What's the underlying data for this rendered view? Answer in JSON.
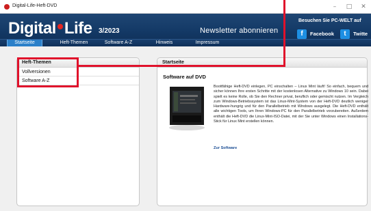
{
  "window": {
    "title": "Digital-Life-Heft-DVD",
    "controls": [
      "–",
      "□",
      "✕"
    ]
  },
  "header": {
    "logo_part1": "Digital",
    "logo_part2": "Life",
    "issue": "3/2023",
    "newsletter": "Newsletter abonnieren",
    "visit_text": "Besuchen Sie PC-WELT auf",
    "facebook_label": "Facebook",
    "twitter_label": "Twitte",
    "facebook_icon": "f",
    "twitter_icon": "t"
  },
  "nav": {
    "items": [
      {
        "label": "Startseite"
      },
      {
        "label": "Heft-Themen"
      },
      {
        "label": "Software A-Z"
      },
      {
        "label": "Hinweis"
      },
      {
        "label": "Impressum"
      }
    ]
  },
  "sidebar": {
    "title": "Heft-Themen",
    "items": [
      {
        "label": "Vollversionen"
      },
      {
        "label": "Software A-Z"
      }
    ]
  },
  "main": {
    "title": "Startseite",
    "section_title": "Software auf DVD",
    "article": "Boottfähige Heft-DVD einlegen, PC einschalten – Linux Mint läuft! So einfach, bequem und sicher können Ihre ersten Schritte mit der kostenlosen Alternative zu Windows 10 sein. Dabei spielt es keine Rolle, ob Sie den Rechner privat, beruflich oder gemischt nutzen. Im Vergleich zum Windows-Betriebssystem ist das Linux-Mint-System von der Heft-DVD deutlich weniger Hardware-hungrig und für den Parallelbetrieb mit Windows ausgelegt. Die Heft-DVD enthält alle wichtigen Tools, um Ihren Windows-PC für den Parallelbetrieb vorzubereiten. Außerdem enthält die Heft-DVD die Linux-Mint-ISO-Datei, mit der Sie unter Windows einen Installations-Stick für Linux Mint erstellen können.",
    "link": "Zur Software"
  },
  "colors": {
    "header_bg": "#143a67",
    "nav_active": "#2b80c9",
    "highlight": "#e0112b",
    "logo_dot": "#e52521",
    "social_icon": "#1d8fe3"
  }
}
